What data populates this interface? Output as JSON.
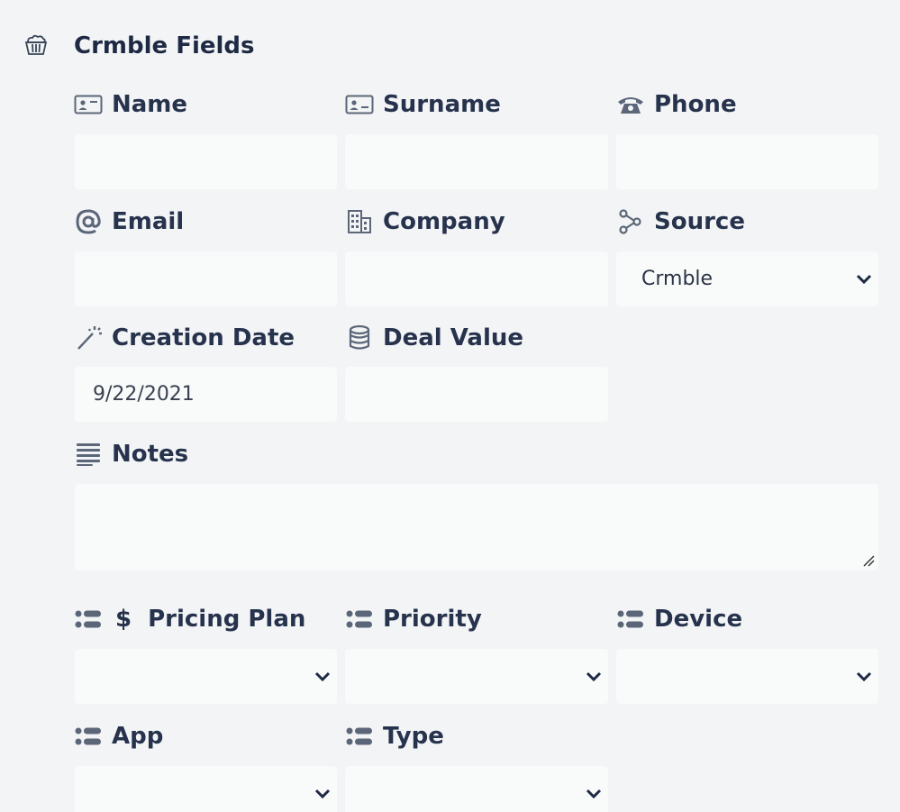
{
  "section": {
    "title": "Crmble Fields",
    "icon": "basket-icon"
  },
  "fields": {
    "name": {
      "label": "Name",
      "icon": "id-card-icon",
      "value": ""
    },
    "surname": {
      "label": "Surname",
      "icon": "id-card-icon",
      "value": ""
    },
    "phone": {
      "label": "Phone",
      "icon": "phone-icon",
      "value": ""
    },
    "email": {
      "label": "Email",
      "icon": "at-icon",
      "value": ""
    },
    "company": {
      "label": "Company",
      "icon": "building-icon",
      "value": ""
    },
    "source": {
      "label": "Source",
      "icon": "share-icon",
      "value": "Crmble"
    },
    "creation_date": {
      "label": "Creation Date",
      "icon": "magic-wand-icon",
      "value": "9/22/2021"
    },
    "deal_value": {
      "label": "Deal Value",
      "icon": "coins-icon",
      "value": ""
    },
    "notes": {
      "label": "Notes",
      "icon": "lines-icon",
      "value": ""
    },
    "pricing_plan": {
      "label": "Pricing Plan",
      "icon": "list-icon",
      "prefix": "$",
      "value": ""
    },
    "priority": {
      "label": "Priority",
      "icon": "list-icon",
      "value": ""
    },
    "device": {
      "label": "Device",
      "icon": "list-icon",
      "value": ""
    },
    "app": {
      "label": "App",
      "icon": "list-icon",
      "value": ""
    },
    "type": {
      "label": "Type",
      "icon": "list-icon",
      "value": ""
    }
  },
  "colors": {
    "background": "#f3f4f6",
    "field": "#f9fafa",
    "text": "#1e2a44",
    "icon": "#5b6678"
  }
}
